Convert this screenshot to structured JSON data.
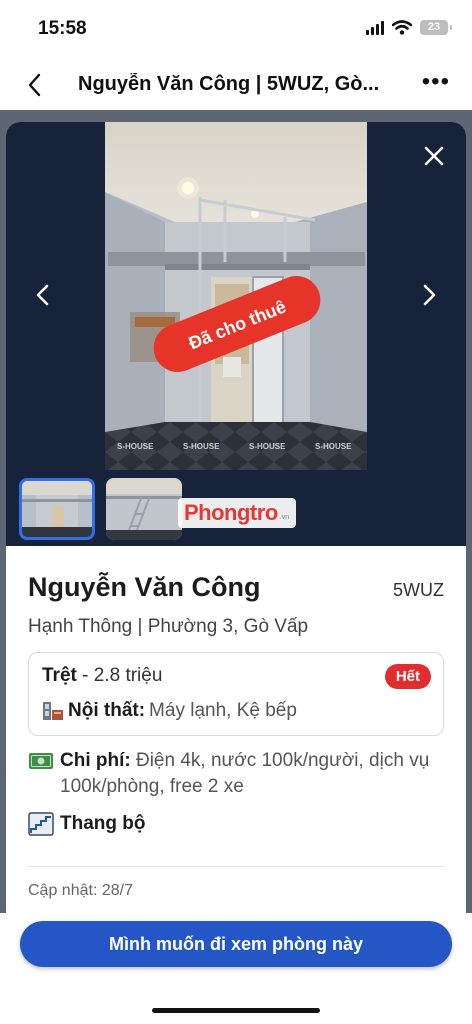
{
  "status_bar": {
    "time": "15:58",
    "battery": "23"
  },
  "nav": {
    "back_icon": "chevron-left-icon",
    "title": "Nguyễn Văn Công | 5WUZ, Gò...",
    "more_icon": "more-horizontal-icon"
  },
  "gallery": {
    "stamp": "Đã cho thuê",
    "watermark": "S-HOUSE",
    "logo_text": "Phongtro",
    "logo_tld": ".vn",
    "close_icon": "close-icon",
    "prev_icon": "chevron-left-icon",
    "next_icon": "chevron-right-icon"
  },
  "listing": {
    "name": "Nguyễn Văn Công",
    "code": "5WUZ",
    "address": "Hạnh Thông | Phường 3, Gò Vấp",
    "room": {
      "floor": "Trệt",
      "separator": " - ",
      "price": "2.8 triệu",
      "status": "Hết",
      "furniture_label": "Nội thất:",
      "furniture_value": "Máy lạnh, Kệ bếp"
    },
    "cost_label": "Chi phí:",
    "cost_value": "Điện 4k, nước 100k/người, dịch vụ 100k/phòng, free 2 xe",
    "stairs": "Thang bộ",
    "updated": "Cập nhật: 28/7"
  },
  "cta": {
    "label": "Mình muốn đi xem phòng này"
  },
  "colors": {
    "accent": "#2457c5",
    "badge": "#e02d2d",
    "gallery_bg": "#17223b"
  }
}
